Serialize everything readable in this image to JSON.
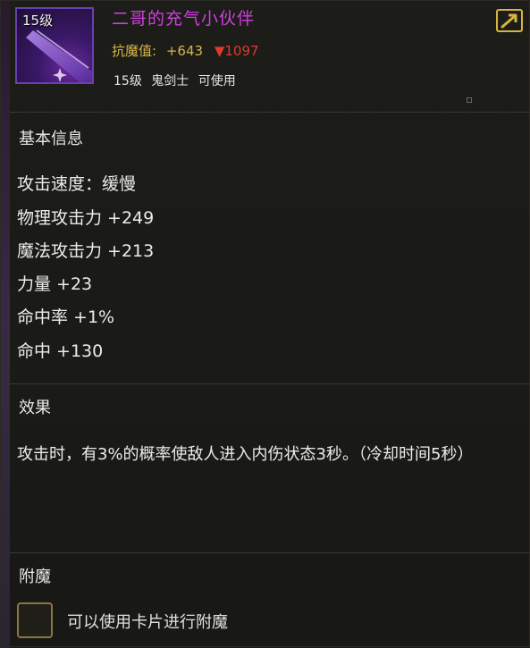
{
  "item": {
    "level_badge": "15级",
    "name": "二哥的充气小伙伴",
    "resist_label": "抗魔值:",
    "resist_value": "+643",
    "resist_down": "▼1097",
    "required_level": "15级",
    "required_class": "鬼剑士",
    "usable": "可使用"
  },
  "icons": {
    "share": "share-export-icon",
    "item": "sword-icon",
    "resist_down": "down-triangle-icon"
  },
  "colors": {
    "name": "#d03fe0",
    "resist": "#d9b64a",
    "resist_down": "#e03a2a",
    "share_icon": "#d8b43e"
  },
  "basic_info": {
    "title": "基本信息",
    "stats": [
      "攻击速度：缓慢",
      "物理攻击力 +249",
      "魔法攻击力 +213",
      "力量 +23",
      "命中率 +1%",
      "命中 +130"
    ]
  },
  "effect": {
    "title": "效果",
    "text": "攻击时，有3%的概率使敌人进入内伤状态3秒。（冷却时间5秒）"
  },
  "enchant": {
    "title": "附魔",
    "card_text": "可以使用卡片进行附魔"
  }
}
